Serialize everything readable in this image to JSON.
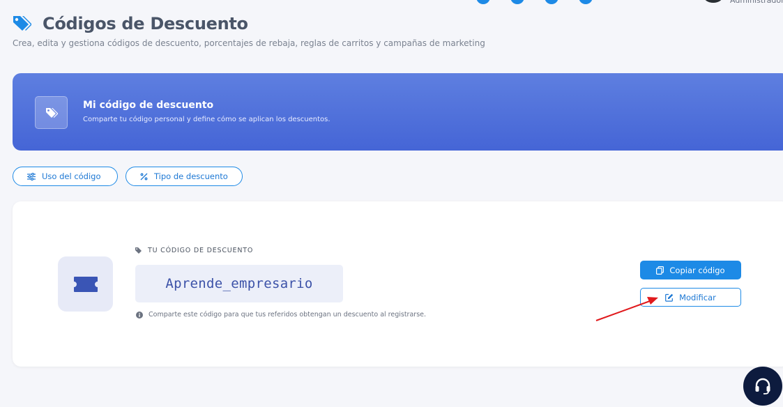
{
  "topbar": {
    "role": "Administrador"
  },
  "header": {
    "title": "Códigos de Descuento",
    "subtitle": "Crea, edita y gestiona códigos de descuento, porcentajes de rebaja, reglas de carritos y campañas de marketing",
    "icon": "tags-icon"
  },
  "banner": {
    "title": "Mi código de descuento",
    "description": "Comparte tu código personal y define cómo se aplican los descuentos.",
    "icon": "tags-icon",
    "gradient_top": "#5e7fe0",
    "gradient_bottom": "#4565d6"
  },
  "tabs": [
    {
      "label": "Uso del código",
      "icon": "sliders-icon"
    },
    {
      "label": "Tipo de descuento",
      "icon": "percent-icon"
    }
  ],
  "code_card": {
    "label": "TU CÓDIGO DE DESCUENTO",
    "code": "Aprende_empresario",
    "hint": "Comparte este código para que tus referidos obtengan un descuento al registrarse.",
    "copy_label": "Copiar código",
    "edit_label": "Modificar"
  },
  "colors": {
    "accent": "#1d8ae6",
    "annotation": "#e0191c",
    "support_bg": "#0d1b3e"
  }
}
